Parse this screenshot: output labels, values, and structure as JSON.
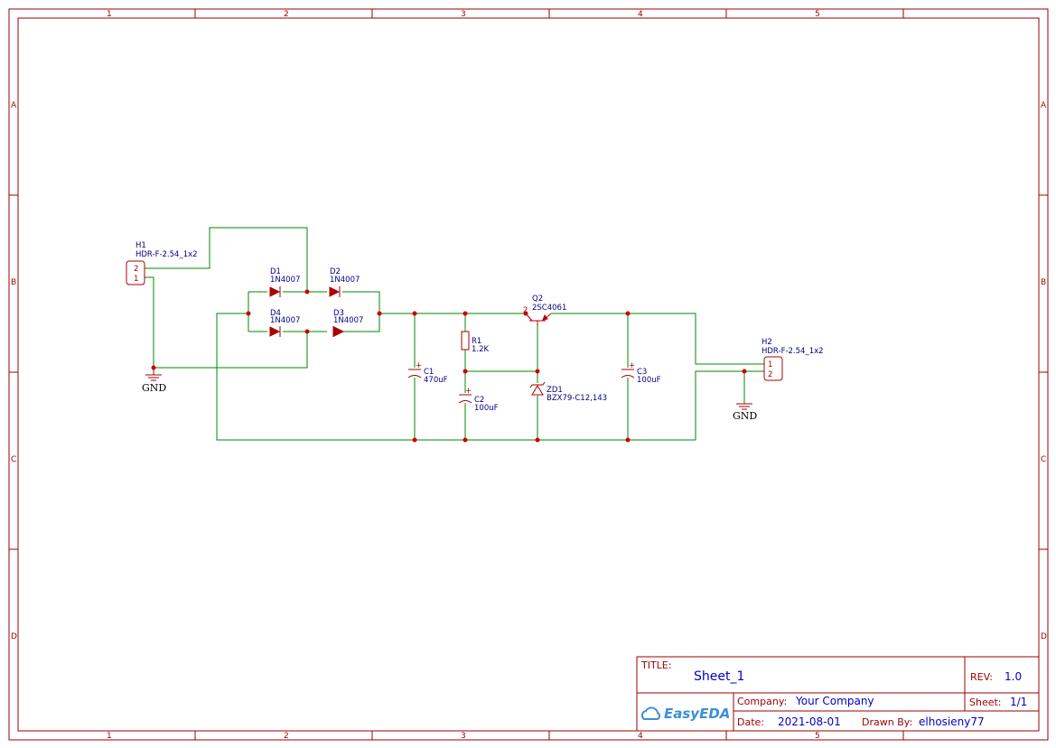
{
  "sheet": {
    "columns": [
      "1",
      "2",
      "3",
      "4",
      "5"
    ],
    "rows": [
      "A",
      "B",
      "C",
      "D"
    ]
  },
  "components": {
    "H1": {
      "ref": "H1",
      "value": "HDR-F-2.54_1x2",
      "pin_top": "2",
      "pin_bottom": "1"
    },
    "H2": {
      "ref": "H2",
      "value": "HDR-F-2.54_1x2",
      "pin_top": "1",
      "pin_bottom": "2"
    },
    "D1": {
      "ref": "D1",
      "value": "1N4007"
    },
    "D2": {
      "ref": "D2",
      "value": "1N4007"
    },
    "D3": {
      "ref": "D3",
      "value": "1N4007"
    },
    "D4": {
      "ref": "D4",
      "value": "1N4007"
    },
    "C1": {
      "ref": "C1",
      "value": "470uF"
    },
    "C2": {
      "ref": "C2",
      "value": "100uF"
    },
    "C3": {
      "ref": "C3",
      "value": "100uF"
    },
    "R1": {
      "ref": "R1",
      "value": "1.2K"
    },
    "Q2": {
      "ref": "Q2",
      "value": "2SC4061",
      "pin_base": "2"
    },
    "ZD1": {
      "ref": "ZD1",
      "value": "BZX79-C12,143"
    }
  },
  "nets": {
    "gnd_left": "GND",
    "gnd_right": "GND",
    "plus": "+"
  },
  "title_block": {
    "title_label": "TITLE:",
    "title_value": "Sheet_1",
    "rev_label": "REV:",
    "rev_value": "1.0",
    "company_label": "Company:",
    "company_value": "Your Company",
    "sheet_label": "Sheet:",
    "sheet_value": "1/1",
    "date_label": "Date:",
    "date_value": "2021-08-01",
    "drawn_label": "Drawn By:",
    "drawn_value": "elhosieny77",
    "logo": "EasyEDA",
    "logo_icon": "cloud-icon"
  },
  "colors": {
    "frame": "#990000",
    "wire": "#008800",
    "component": "#aa0000",
    "label": "#000080",
    "title_value": "#0000cc"
  }
}
